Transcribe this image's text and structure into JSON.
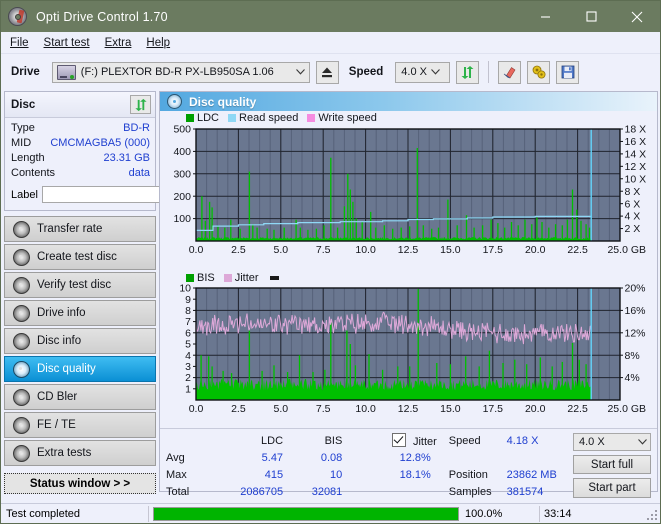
{
  "window": {
    "title": "Opti Drive Control 1.70",
    "icon": "disc-icon",
    "minimize": "minimize-icon",
    "maximize": "maximize-icon",
    "close": "close-icon"
  },
  "menu": [
    {
      "label": "File",
      "accel": "F"
    },
    {
      "label": "Start test",
      "accel": "S"
    },
    {
      "label": "Extra",
      "accel": "x"
    },
    {
      "label": "Help",
      "accel": "H"
    }
  ],
  "toolbar": {
    "drive_label": "Drive",
    "drive_value": "(F:)  PLEXTOR BD-R  PX-LB950SA 1.06",
    "eject_icon": "eject-icon",
    "speed_label": "Speed",
    "speed_value": "4.0 X",
    "refresh_icon": "refresh-icon",
    "erase_icon": "eraser-icon",
    "settings_icon": "gears-icon",
    "save_icon": "floppy-save-icon"
  },
  "disc": {
    "header": "Disc",
    "refresh_icon": "refresh-icon",
    "rows": [
      {
        "key": "Type",
        "value": "BD-R"
      },
      {
        "key": "MID",
        "value": "CMCMAGBA5 (000)"
      },
      {
        "key": "Length",
        "value": "23.31 GB"
      },
      {
        "key": "Contents",
        "value": "data"
      }
    ],
    "label_key": "Label",
    "label_value": "",
    "label_placeholder": "",
    "label_button_icon": "cd-icon"
  },
  "nav": {
    "items": [
      {
        "label": "Transfer rate",
        "active": false
      },
      {
        "label": "Create test disc",
        "active": false
      },
      {
        "label": "Verify test disc",
        "active": false
      },
      {
        "label": "Drive info",
        "active": false
      },
      {
        "label": "Disc info",
        "active": false
      },
      {
        "label": "Disc quality",
        "active": true
      },
      {
        "label": "CD Bler",
        "active": false
      },
      {
        "label": "FE / TE",
        "active": false
      },
      {
        "label": "Extra tests",
        "active": false
      }
    ],
    "status_window": "Status window > >"
  },
  "main": {
    "header": "Disc quality",
    "header_icon": "disc-quality-icon"
  },
  "stats": {
    "col_ldc": "LDC",
    "col_bis": "BIS",
    "jitter_label": "Jitter",
    "jitter_checked": true,
    "rows": [
      {
        "name": "Avg",
        "ldc": "5.47",
        "bis": "0.08",
        "jitter": "12.8%"
      },
      {
        "name": "Max",
        "ldc": "415",
        "bis": "10",
        "jitter": "18.1%"
      },
      {
        "name": "Total",
        "ldc": "2086705",
        "bis": "32081",
        "jitter": ""
      }
    ],
    "speed_label": "Speed",
    "speed_value": "4.18 X",
    "position_label": "Position",
    "position_value": "23862 MB",
    "samples_label": "Samples",
    "samples_value": "381574",
    "speed_select": "4.0 X",
    "start_full": "Start full",
    "start_part": "Start part"
  },
  "statusbar": {
    "text": "Test completed",
    "progress_percent": "100.0%",
    "progress_value": 100,
    "elapsed": "33:14"
  },
  "colors": {
    "titlebar": "#6b7b60",
    "ldc_green": "#00c000",
    "read_speed": "#8fd8f5",
    "write_speed": "#f58ce0",
    "bis_green": "#00c000",
    "jitter_pink": "#dda8d8",
    "plot_bg": "#6a7790",
    "accent_blue": "#0b8fd4",
    "value_blue": "#1f3fd0",
    "progress_green": "#00b400"
  },
  "chart_data": [
    {
      "type": "line",
      "name": "disc-quality-ldc",
      "title": "",
      "xlabel": "GB",
      "ylabel": "LDC",
      "xlim": [
        0,
        25
      ],
      "ylim": [
        0,
        500
      ],
      "y2lim": [
        0,
        18
      ],
      "y2label": "X",
      "xticks": [
        "0.0",
        "2.5",
        "5.0",
        "7.5",
        "10.0",
        "12.5",
        "15.0",
        "17.5",
        "20.0",
        "22.5",
        "25.0 GB"
      ],
      "yticks": [
        "100",
        "200",
        "300",
        "400",
        "500"
      ],
      "y2ticks": [
        "2 X",
        "4 X",
        "6 X",
        "8 X",
        "10 X",
        "12 X",
        "14 X",
        "16 X",
        "18 X"
      ],
      "grid": true,
      "legend": [
        {
          "label": "LDC",
          "color": "#00a000"
        },
        {
          "label": "Read speed",
          "color": "#8fd8f5"
        },
        {
          "label": "Write speed",
          "color": "#f58ce0"
        }
      ],
      "series": [
        {
          "name": "LDC",
          "color": "#00c000",
          "type": "impulse",
          "baseline": 18,
          "peaks": [
            {
              "x": 0.35,
              "y": 200
            },
            {
              "x": 0.55,
              "y": 90
            },
            {
              "x": 0.8,
              "y": 175
            },
            {
              "x": 0.95,
              "y": 150
            },
            {
              "x": 1.3,
              "y": 70
            },
            {
              "x": 1.7,
              "y": 60
            },
            {
              "x": 2.05,
              "y": 95
            },
            {
              "x": 2.6,
              "y": 55
            },
            {
              "x": 3.15,
              "y": 310
            },
            {
              "x": 3.35,
              "y": 75
            },
            {
              "x": 3.6,
              "y": 60
            },
            {
              "x": 4.2,
              "y": 55
            },
            {
              "x": 4.6,
              "y": 50
            },
            {
              "x": 5.2,
              "y": 60
            },
            {
              "x": 5.9,
              "y": 95
            },
            {
              "x": 6.15,
              "y": 60
            },
            {
              "x": 6.6,
              "y": 50
            },
            {
              "x": 7.1,
              "y": 55
            },
            {
              "x": 7.55,
              "y": 70
            },
            {
              "x": 7.95,
              "y": 372
            },
            {
              "x": 8.35,
              "y": 60
            },
            {
              "x": 8.75,
              "y": 155
            },
            {
              "x": 8.95,
              "y": 300
            },
            {
              "x": 9.1,
              "y": 230
            },
            {
              "x": 9.25,
              "y": 175
            },
            {
              "x": 9.45,
              "y": 100
            },
            {
              "x": 9.8,
              "y": 85
            },
            {
              "x": 10.3,
              "y": 130
            },
            {
              "x": 10.6,
              "y": 60
            },
            {
              "x": 11.1,
              "y": 70
            },
            {
              "x": 11.6,
              "y": 55
            },
            {
              "x": 12.1,
              "y": 60
            },
            {
              "x": 12.6,
              "y": 65
            },
            {
              "x": 13.05,
              "y": 415
            },
            {
              "x": 13.4,
              "y": 70
            },
            {
              "x": 13.9,
              "y": 55
            },
            {
              "x": 14.3,
              "y": 60
            },
            {
              "x": 14.85,
              "y": 185
            },
            {
              "x": 15.4,
              "y": 70
            },
            {
              "x": 15.95,
              "y": 115
            },
            {
              "x": 16.4,
              "y": 60
            },
            {
              "x": 16.9,
              "y": 70
            },
            {
              "x": 17.4,
              "y": 95
            },
            {
              "x": 17.8,
              "y": 80
            },
            {
              "x": 18.2,
              "y": 60
            },
            {
              "x": 18.6,
              "y": 85
            },
            {
              "x": 19.0,
              "y": 70
            },
            {
              "x": 19.4,
              "y": 95
            },
            {
              "x": 19.8,
              "y": 75
            },
            {
              "x": 20.1,
              "y": 105
            },
            {
              "x": 20.4,
              "y": 85
            },
            {
              "x": 20.8,
              "y": 60
            },
            {
              "x": 21.2,
              "y": 75
            },
            {
              "x": 21.6,
              "y": 70
            },
            {
              "x": 21.9,
              "y": 95
            },
            {
              "x": 22.2,
              "y": 230
            },
            {
              "x": 22.45,
              "y": 140
            },
            {
              "x": 22.7,
              "y": 90
            },
            {
              "x": 23.0,
              "y": 75
            },
            {
              "x": 23.2,
              "y": 60
            }
          ]
        },
        {
          "name": "Read speed",
          "color": "#8fd8f5",
          "type": "step",
          "points": [
            {
              "x": 0.0,
              "y": 1.7
            },
            {
              "x": 1.0,
              "y": 2.4
            },
            {
              "x": 2.5,
              "y": 2.6
            },
            {
              "x": 4.0,
              "y": 2.8
            },
            {
              "x": 6.0,
              "y": 2.95
            },
            {
              "x": 8.5,
              "y": 3.1
            },
            {
              "x": 11.0,
              "y": 3.25
            },
            {
              "x": 12.5,
              "y": 3.45
            },
            {
              "x": 14.0,
              "y": 3.55
            },
            {
              "x": 16.0,
              "y": 3.7
            },
            {
              "x": 17.5,
              "y": 3.85
            },
            {
              "x": 20.0,
              "y": 3.95
            },
            {
              "x": 23.3,
              "y": 4.05
            }
          ],
          "axis": "y2"
        }
      ],
      "cursor_x": 23.3
    },
    {
      "type": "line",
      "name": "disc-quality-bis-jitter",
      "title": "",
      "xlabel": "GB",
      "ylabel": "BIS",
      "xlim": [
        0,
        25
      ],
      "ylim": [
        0,
        10
      ],
      "y2lim": [
        0,
        20
      ],
      "y2label": "%",
      "xticks": [
        "0.0",
        "2.5",
        "5.0",
        "7.5",
        "10.0",
        "12.5",
        "15.0",
        "17.5",
        "20.0",
        "22.5",
        "25.0 GB"
      ],
      "yticks": [
        "1",
        "2",
        "3",
        "4",
        "5",
        "6",
        "7",
        "8",
        "9",
        "10"
      ],
      "y2ticks": [
        "4%",
        "8%",
        "12%",
        "16%",
        "20%"
      ],
      "grid": true,
      "legend": [
        {
          "label": "BIS",
          "color": "#00a000"
        },
        {
          "label": "Jitter",
          "color": "#dda8d8"
        }
      ],
      "series": [
        {
          "name": "BIS",
          "color": "#00c000",
          "type": "impulse",
          "baseline": 1.9,
          "peaks": [
            {
              "x": 0.3,
              "y": 4.0
            },
            {
              "x": 0.75,
              "y": 3.9
            },
            {
              "x": 0.95,
              "y": 3.0
            },
            {
              "x": 1.6,
              "y": 2.6
            },
            {
              "x": 2.1,
              "y": 2.4
            },
            {
              "x": 3.15,
              "y": 6.2
            },
            {
              "x": 3.9,
              "y": 2.6
            },
            {
              "x": 4.6,
              "y": 3.1
            },
            {
              "x": 5.4,
              "y": 2.5
            },
            {
              "x": 6.1,
              "y": 4.0
            },
            {
              "x": 6.9,
              "y": 2.5
            },
            {
              "x": 7.6,
              "y": 2.7
            },
            {
              "x": 7.95,
              "y": 6.9
            },
            {
              "x": 8.9,
              "y": 6.2
            },
            {
              "x": 9.1,
              "y": 5.0
            },
            {
              "x": 9.4,
              "y": 3.1
            },
            {
              "x": 10.2,
              "y": 4.1
            },
            {
              "x": 11.0,
              "y": 2.7
            },
            {
              "x": 11.9,
              "y": 3.0
            },
            {
              "x": 12.6,
              "y": 3.0
            },
            {
              "x": 13.1,
              "y": 9.9
            },
            {
              "x": 14.2,
              "y": 3.3
            },
            {
              "x": 15.0,
              "y": 3.2
            },
            {
              "x": 15.9,
              "y": 3.9
            },
            {
              "x": 16.7,
              "y": 3.0
            },
            {
              "x": 17.3,
              "y": 4.4
            },
            {
              "x": 18.1,
              "y": 3.3
            },
            {
              "x": 18.8,
              "y": 3.6
            },
            {
              "x": 19.5,
              "y": 3.2
            },
            {
              "x": 20.3,
              "y": 3.8
            },
            {
              "x": 21.0,
              "y": 3.0
            },
            {
              "x": 21.6,
              "y": 3.4
            },
            {
              "x": 22.2,
              "y": 5.1
            },
            {
              "x": 22.6,
              "y": 3.6
            },
            {
              "x": 23.0,
              "y": 3.2
            }
          ]
        },
        {
          "name": "Jitter",
          "color": "#dda8d8",
          "type": "noise-line",
          "axis": "y2",
          "trend": [
            {
              "x": 0.0,
              "y": 13.4
            },
            {
              "x": 2.0,
              "y": 13.6
            },
            {
              "x": 5.0,
              "y": 13.3
            },
            {
              "x": 8.0,
              "y": 13.4
            },
            {
              "x": 11.0,
              "y": 13.8
            },
            {
              "x": 13.5,
              "y": 13.2
            },
            {
              "x": 16.0,
              "y": 12.3
            },
            {
              "x": 19.0,
              "y": 11.8
            },
            {
              "x": 21.5,
              "y": 12.1
            },
            {
              "x": 23.3,
              "y": 11.9
            }
          ],
          "avg": 12.8,
          "max": 18.1
        }
      ],
      "cursor_x": 23.3
    }
  ]
}
